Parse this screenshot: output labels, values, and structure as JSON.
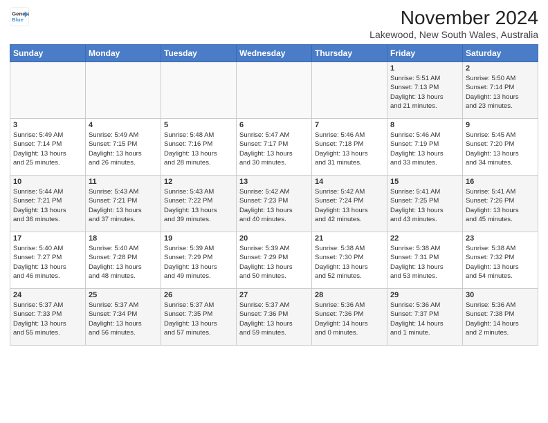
{
  "logo": {
    "line1": "General",
    "line2": "Blue"
  },
  "title": "November 2024",
  "subtitle": "Lakewood, New South Wales, Australia",
  "headers": [
    "Sunday",
    "Monday",
    "Tuesday",
    "Wednesday",
    "Thursday",
    "Friday",
    "Saturday"
  ],
  "weeks": [
    [
      {
        "day": "",
        "detail": ""
      },
      {
        "day": "",
        "detail": ""
      },
      {
        "day": "",
        "detail": ""
      },
      {
        "day": "",
        "detail": ""
      },
      {
        "day": "",
        "detail": ""
      },
      {
        "day": "1",
        "detail": "Sunrise: 5:51 AM\nSunset: 7:13 PM\nDaylight: 13 hours\nand 21 minutes."
      },
      {
        "day": "2",
        "detail": "Sunrise: 5:50 AM\nSunset: 7:14 PM\nDaylight: 13 hours\nand 23 minutes."
      }
    ],
    [
      {
        "day": "3",
        "detail": "Sunrise: 5:49 AM\nSunset: 7:14 PM\nDaylight: 13 hours\nand 25 minutes."
      },
      {
        "day": "4",
        "detail": "Sunrise: 5:49 AM\nSunset: 7:15 PM\nDaylight: 13 hours\nand 26 minutes."
      },
      {
        "day": "5",
        "detail": "Sunrise: 5:48 AM\nSunset: 7:16 PM\nDaylight: 13 hours\nand 28 minutes."
      },
      {
        "day": "6",
        "detail": "Sunrise: 5:47 AM\nSunset: 7:17 PM\nDaylight: 13 hours\nand 30 minutes."
      },
      {
        "day": "7",
        "detail": "Sunrise: 5:46 AM\nSunset: 7:18 PM\nDaylight: 13 hours\nand 31 minutes."
      },
      {
        "day": "8",
        "detail": "Sunrise: 5:46 AM\nSunset: 7:19 PM\nDaylight: 13 hours\nand 33 minutes."
      },
      {
        "day": "9",
        "detail": "Sunrise: 5:45 AM\nSunset: 7:20 PM\nDaylight: 13 hours\nand 34 minutes."
      }
    ],
    [
      {
        "day": "10",
        "detail": "Sunrise: 5:44 AM\nSunset: 7:21 PM\nDaylight: 13 hours\nand 36 minutes."
      },
      {
        "day": "11",
        "detail": "Sunrise: 5:43 AM\nSunset: 7:21 PM\nDaylight: 13 hours\nand 37 minutes."
      },
      {
        "day": "12",
        "detail": "Sunrise: 5:43 AM\nSunset: 7:22 PM\nDaylight: 13 hours\nand 39 minutes."
      },
      {
        "day": "13",
        "detail": "Sunrise: 5:42 AM\nSunset: 7:23 PM\nDaylight: 13 hours\nand 40 minutes."
      },
      {
        "day": "14",
        "detail": "Sunrise: 5:42 AM\nSunset: 7:24 PM\nDaylight: 13 hours\nand 42 minutes."
      },
      {
        "day": "15",
        "detail": "Sunrise: 5:41 AM\nSunset: 7:25 PM\nDaylight: 13 hours\nand 43 minutes."
      },
      {
        "day": "16",
        "detail": "Sunrise: 5:41 AM\nSunset: 7:26 PM\nDaylight: 13 hours\nand 45 minutes."
      }
    ],
    [
      {
        "day": "17",
        "detail": "Sunrise: 5:40 AM\nSunset: 7:27 PM\nDaylight: 13 hours\nand 46 minutes."
      },
      {
        "day": "18",
        "detail": "Sunrise: 5:40 AM\nSunset: 7:28 PM\nDaylight: 13 hours\nand 48 minutes."
      },
      {
        "day": "19",
        "detail": "Sunrise: 5:39 AM\nSunset: 7:29 PM\nDaylight: 13 hours\nand 49 minutes."
      },
      {
        "day": "20",
        "detail": "Sunrise: 5:39 AM\nSunset: 7:29 PM\nDaylight: 13 hours\nand 50 minutes."
      },
      {
        "day": "21",
        "detail": "Sunrise: 5:38 AM\nSunset: 7:30 PM\nDaylight: 13 hours\nand 52 minutes."
      },
      {
        "day": "22",
        "detail": "Sunrise: 5:38 AM\nSunset: 7:31 PM\nDaylight: 13 hours\nand 53 minutes."
      },
      {
        "day": "23",
        "detail": "Sunrise: 5:38 AM\nSunset: 7:32 PM\nDaylight: 13 hours\nand 54 minutes."
      }
    ],
    [
      {
        "day": "24",
        "detail": "Sunrise: 5:37 AM\nSunset: 7:33 PM\nDaylight: 13 hours\nand 55 minutes."
      },
      {
        "day": "25",
        "detail": "Sunrise: 5:37 AM\nSunset: 7:34 PM\nDaylight: 13 hours\nand 56 minutes."
      },
      {
        "day": "26",
        "detail": "Sunrise: 5:37 AM\nSunset: 7:35 PM\nDaylight: 13 hours\nand 57 minutes."
      },
      {
        "day": "27",
        "detail": "Sunrise: 5:37 AM\nSunset: 7:36 PM\nDaylight: 13 hours\nand 59 minutes."
      },
      {
        "day": "28",
        "detail": "Sunrise: 5:36 AM\nSunset: 7:36 PM\nDaylight: 14 hours\nand 0 minutes."
      },
      {
        "day": "29",
        "detail": "Sunrise: 5:36 AM\nSunset: 7:37 PM\nDaylight: 14 hours\nand 1 minute."
      },
      {
        "day": "30",
        "detail": "Sunrise: 5:36 AM\nSunset: 7:38 PM\nDaylight: 14 hours\nand 2 minutes."
      }
    ]
  ]
}
